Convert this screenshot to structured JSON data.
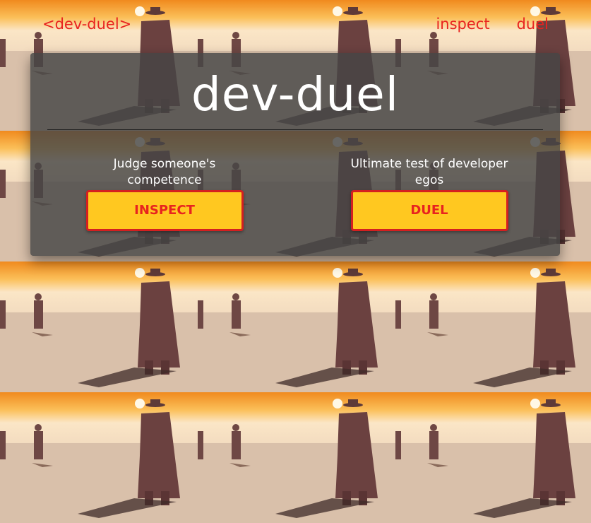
{
  "nav": {
    "brand": "<dev-duel>",
    "links": [
      "inspect",
      "duel"
    ]
  },
  "hero": {
    "title": "dev-duel",
    "inspect": {
      "description": "Judge someone's competence",
      "button": "INSPECT"
    },
    "duel": {
      "description": "Ultimate test of developer egos",
      "button": "DUEL"
    }
  },
  "colors": {
    "accent": "#e8231f",
    "button_fill": "#ffc820",
    "panel": "#464646",
    "sky": "#f7a23a"
  }
}
